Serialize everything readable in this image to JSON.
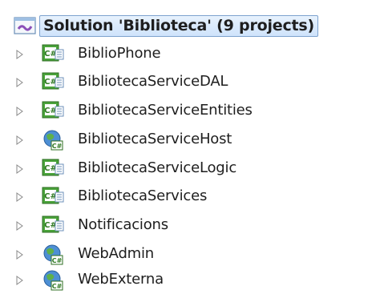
{
  "solution": {
    "label": "Solution 'Biblioteca' (9 projects)",
    "icon": "solution-icon"
  },
  "projects": [
    {
      "label": "BiblioPhone",
      "icon": "csharp-project-icon"
    },
    {
      "label": "BibliotecaServiceDAL",
      "icon": "csharp-project-icon"
    },
    {
      "label": "BibliotecaServiceEntities",
      "icon": "csharp-project-icon"
    },
    {
      "label": "BibliotecaServiceHost",
      "icon": "csharp-web-project-icon"
    },
    {
      "label": "BibliotecaServiceLogic",
      "icon": "csharp-project-icon"
    },
    {
      "label": "BibliotecaServices",
      "icon": "csharp-project-icon"
    },
    {
      "label": "Notificacions",
      "icon": "csharp-project-icon"
    },
    {
      "label": "WebAdmin",
      "icon": "csharp-web-project-icon"
    },
    {
      "label": "WebExterna",
      "icon": "csharp-web-project-icon"
    }
  ],
  "colors": {
    "selection_border": "#7da2ce",
    "selection_fill": "#cfe3fb",
    "csharp_green": "#3e9a2e"
  }
}
